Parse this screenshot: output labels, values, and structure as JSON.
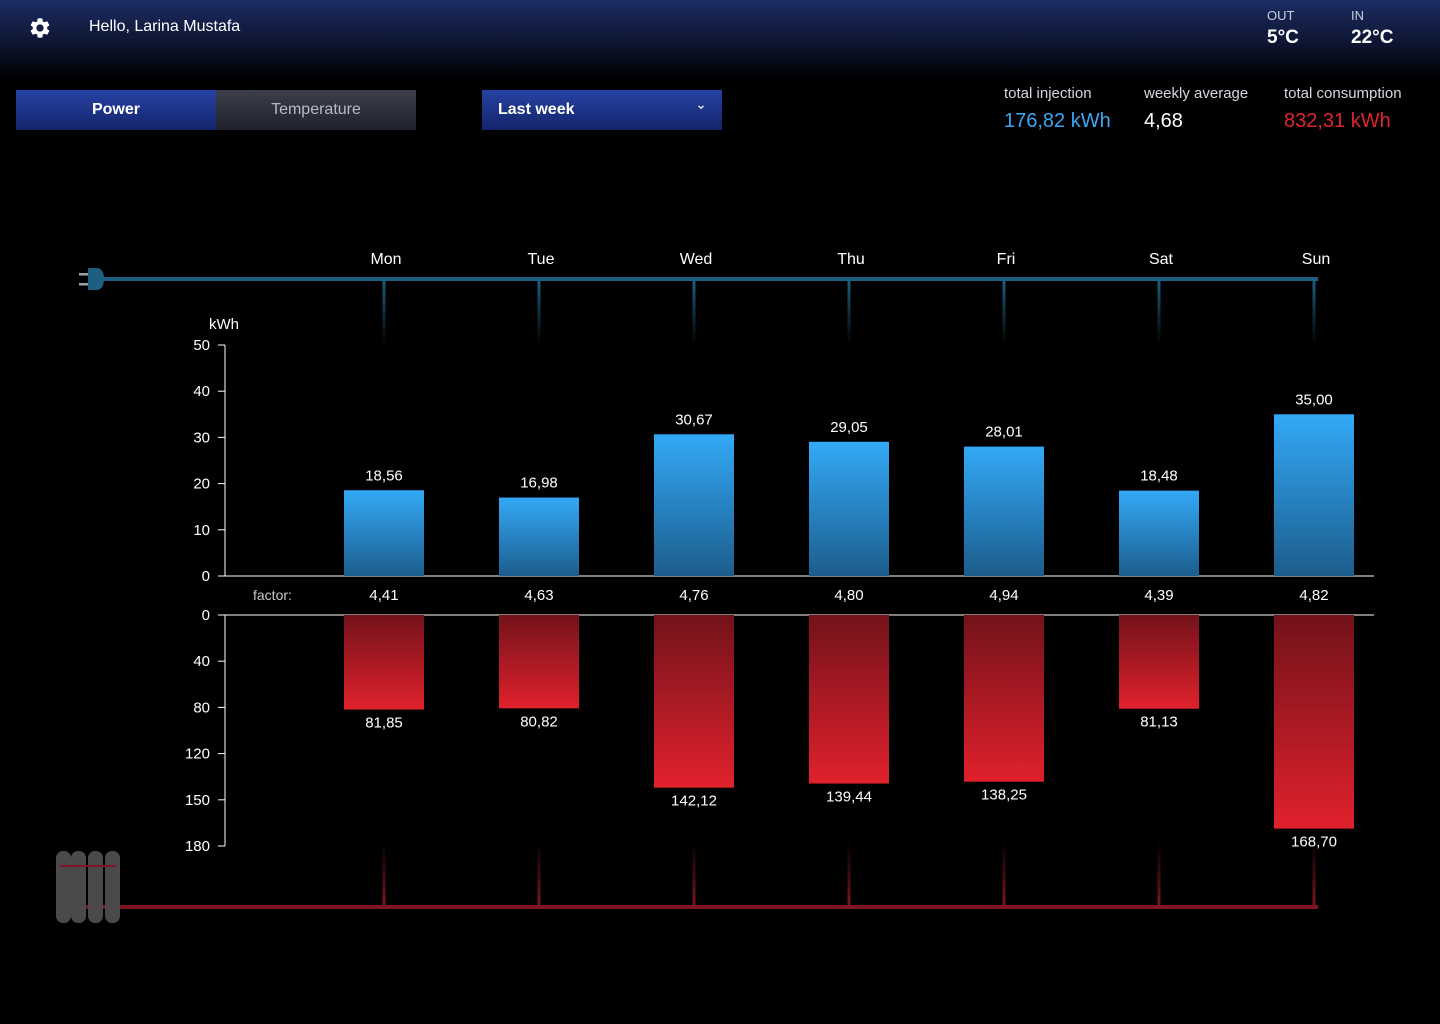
{
  "header": {
    "greeting": "Hello, Larina Mustafa",
    "out_label": "OUT",
    "out_value": "5°C",
    "in_label": "IN",
    "in_value": "22°C"
  },
  "tabs": {
    "power": "Power",
    "temperature": "Temperature",
    "active": "Power"
  },
  "period": {
    "selected": "Last week"
  },
  "stats": {
    "injection_label": "total injection",
    "injection_value": "176,82 kWh",
    "average_label": "weekly average",
    "average_value": "4,68",
    "consumption_label": "total consumption",
    "consumption_value": "832,31 kWh"
  },
  "colors": {
    "injection": "#2f9fec",
    "consumption": "#d9202b",
    "accent": "#2642a4"
  },
  "icons": {
    "settings": "gear-icon",
    "dropdown": "chevron-down-icon",
    "injection_source": "plug-icon",
    "consumption_sink": "radiator-icon"
  },
  "chart_data": {
    "type": "bar",
    "categories": [
      "Mon",
      "Tue",
      "Wed",
      "Thu",
      "Fri",
      "Sat",
      "Sun"
    ],
    "unit_label": "kWh",
    "factor_label": "factor:",
    "series": [
      {
        "name": "total injection",
        "values": [
          18.56,
          16.98,
          30.67,
          29.05,
          28.01,
          18.48,
          35.0
        ],
        "labels": [
          "18,56",
          "16,98",
          "30,67",
          "29,05",
          "28,01",
          "18,48",
          "35,00"
        ]
      },
      {
        "name": "total consumption",
        "values": [
          81.85,
          80.82,
          142.12,
          139.44,
          138.25,
          81.13,
          168.7
        ],
        "labels": [
          "81,85",
          "80,82",
          "142,12",
          "139,44",
          "138,25",
          "81,13",
          "168,70"
        ]
      }
    ],
    "factors": [
      "4,41",
      "4,63",
      "4,76",
      "4,80",
      "4,94",
      "4,39",
      "4,82"
    ],
    "upper_axis": {
      "ticks": [
        0,
        10,
        20,
        30,
        40,
        50
      ],
      "ylim": [
        0,
        50
      ]
    },
    "lower_axis": {
      "ticks": [
        0,
        40,
        80,
        120,
        150,
        180
      ],
      "ylim": [
        0,
        180
      ]
    }
  }
}
